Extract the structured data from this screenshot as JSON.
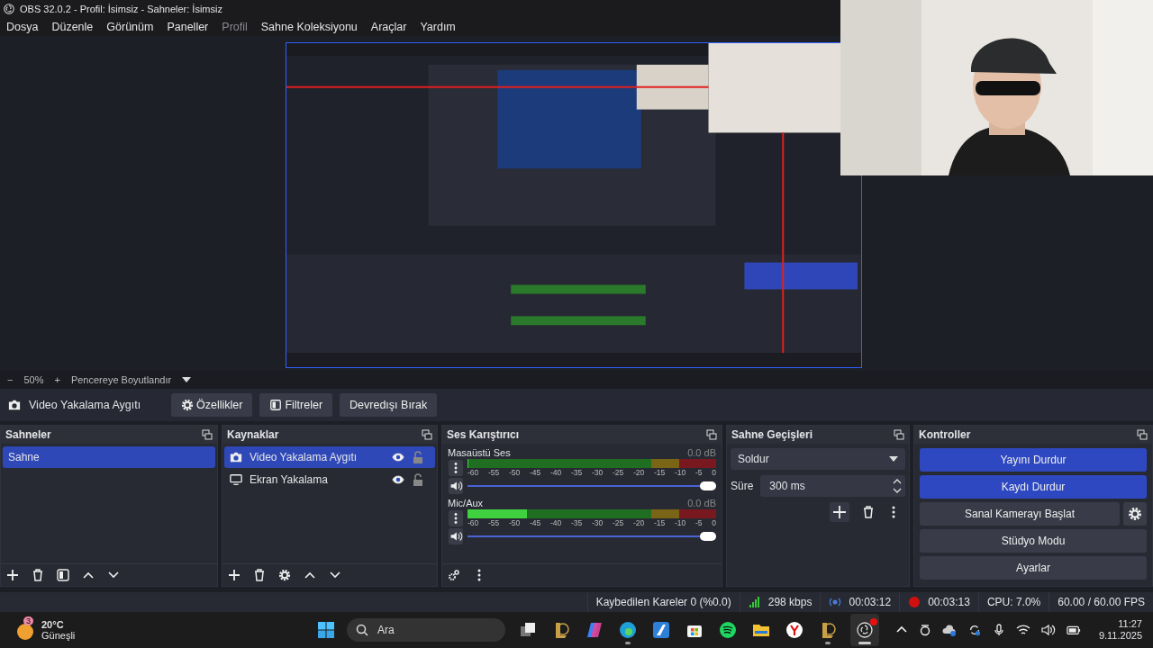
{
  "window": {
    "title": "OBS 32.0.2 - Profil: İsimsiz - Sahneler: İsimsiz"
  },
  "menu": [
    {
      "label": "Dosya",
      "disabled": false
    },
    {
      "label": "Düzenle",
      "disabled": false
    },
    {
      "label": "Görünüm",
      "disabled": false
    },
    {
      "label": "Paneller",
      "disabled": false
    },
    {
      "label": "Profil",
      "disabled": true
    },
    {
      "label": "Sahne Koleksiyonu",
      "disabled": false
    },
    {
      "label": "Araçlar",
      "disabled": false
    },
    {
      "label": "Yardım",
      "disabled": false
    }
  ],
  "zoom_bar": {
    "minus": "−",
    "zoom": "50%",
    "plus": "+",
    "mode": "Pencereye Boyutlandır"
  },
  "source_toolbar": {
    "source": "Video Yakalama Aygıtı",
    "buttons": [
      {
        "label": "Özellikler",
        "kind": "gear"
      },
      {
        "label": "Filtreler",
        "kind": "filter"
      },
      {
        "label": "Devredışı Bırak",
        "kind": "plain"
      }
    ]
  },
  "scenes": {
    "title": "Sahneler",
    "items": [
      {
        "label": "Sahne",
        "selected": true
      }
    ]
  },
  "sources": {
    "title": "Kaynaklar",
    "items": [
      {
        "label": "Video Yakalama Aygıtı",
        "kind": "camera",
        "selected": true,
        "visible": true,
        "locked": false
      },
      {
        "label": "Ekran Yakalama",
        "kind": "display",
        "selected": false,
        "visible": true,
        "locked": false
      }
    ]
  },
  "mixer": {
    "title": "Ses Karıştırıcı",
    "channels": [
      {
        "name": "Masaüstü Ses",
        "reading": "0.0 dB",
        "meter": {
          "level": 0
        },
        "fader": {
          "level": 1
        },
        "ticks": [
          "-60",
          "-55",
          "-50",
          "-45",
          "-40",
          "-35",
          "-30",
          "-25",
          "-20",
          "-15",
          "-10",
          "-5",
          "0"
        ]
      },
      {
        "name": "Mic/Aux",
        "reading": "0.0 dB",
        "meter": {
          "level": 0.24
        },
        "fader": {
          "level": 1
        },
        "ticks": [
          "-60",
          "-55",
          "-50",
          "-45",
          "-40",
          "-35",
          "-30",
          "-25",
          "-20",
          "-15",
          "-10",
          "-5",
          "0"
        ]
      }
    ]
  },
  "transitions": {
    "title": "Sahne Geçişleri",
    "transition": "Soldur",
    "duration_label": "Süre",
    "duration": "300 ms"
  },
  "controls": {
    "title": "Kontroller",
    "buttons": [
      {
        "label": "Yayını Durdur",
        "active": true,
        "settings": false
      },
      {
        "label": "Kaydı Durdur",
        "active": true,
        "settings": false
      },
      {
        "label": "Sanal Kamerayı Başlat",
        "active": false,
        "settings": true
      },
      {
        "label": "Stüdyo Modu",
        "active": false,
        "settings": false
      },
      {
        "label": "Ayarlar",
        "active": false,
        "settings": false
      }
    ]
  },
  "status_bar": {
    "dropped": "Kaybedilen Kareler 0 (%0.0)",
    "bitrate": "298 kbps",
    "stream_time": "00:03:12",
    "rec_time": "00:03:13",
    "cpu": "CPU: 7.0%",
    "fps": "60.00 / 60.00 FPS"
  },
  "taskbar": {
    "weather": {
      "badge": "3",
      "temp": "20°C",
      "desc": "Güneşli"
    },
    "search": {
      "placeholder": "Ara"
    },
    "apps": [
      {
        "kind": "taskview",
        "running": false,
        "selected": false
      },
      {
        "kind": "league",
        "running": false,
        "selected": false
      },
      {
        "kind": "copilot",
        "running": false,
        "selected": false
      },
      {
        "kind": "edge",
        "running": true,
        "selected": false
      },
      {
        "kind": "launcher",
        "running": false,
        "selected": false
      },
      {
        "kind": "store",
        "running": false,
        "selected": false
      },
      {
        "kind": "spotify",
        "running": false,
        "selected": false
      },
      {
        "kind": "folder",
        "running": false,
        "selected": false
      },
      {
        "kind": "yandex",
        "running": false,
        "selected": false
      },
      {
        "kind": "league",
        "running": true,
        "selected": false
      },
      {
        "kind": "obs",
        "running": true,
        "selected": true
      }
    ],
    "clock": {
      "time": "11:27",
      "date": "9.11.2025"
    }
  }
}
